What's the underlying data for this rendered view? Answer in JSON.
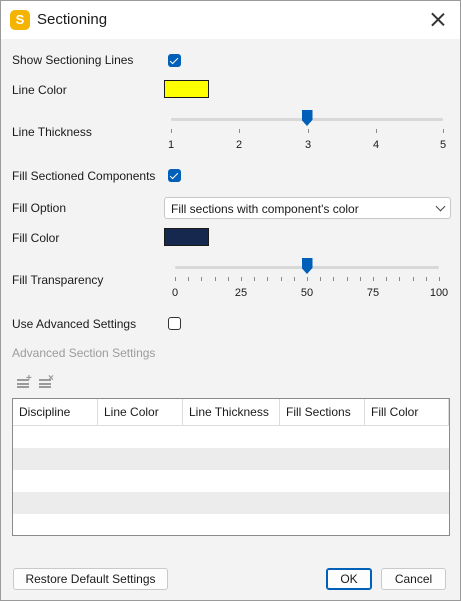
{
  "window": {
    "title": "Sectioning",
    "app_icon_letter": "S"
  },
  "show_sectioning_lines": {
    "label": "Show Sectioning Lines",
    "checked": true
  },
  "line_color": {
    "label": "Line Color",
    "color": "#ffff00"
  },
  "line_thickness": {
    "label": "Line Thickness",
    "min": 1,
    "max": 5,
    "value": 3,
    "tick_labels": [
      "1",
      "2",
      "3",
      "4",
      "5"
    ]
  },
  "fill_sectioned_components": {
    "label": "Fill Sectioned Components",
    "checked": true
  },
  "fill_option": {
    "label": "Fill Option",
    "selected": "Fill sections with component's color"
  },
  "fill_color": {
    "label": "Fill Color",
    "color": "#17284f"
  },
  "fill_transparency": {
    "label": "Fill Transparency",
    "min": 0,
    "max": 100,
    "value": 50,
    "tick_labels": [
      "0",
      "25",
      "50",
      "75",
      "100"
    ]
  },
  "use_advanced_settings": {
    "label": "Use Advanced Settings",
    "checked": false
  },
  "advanced": {
    "title": "Advanced Section Settings",
    "toolbar": {
      "add_icon": "add-row-icon",
      "delete_icon": "delete-row-icon"
    },
    "table": {
      "columns": [
        "Discipline",
        "Line Color",
        "Line Thickness",
        "Fill Sections",
        "Fill Color"
      ],
      "rows": []
    }
  },
  "buttons": {
    "restore": "Restore Default Settings",
    "ok": "OK",
    "cancel": "Cancel"
  },
  "accent_color": "#005fb8"
}
